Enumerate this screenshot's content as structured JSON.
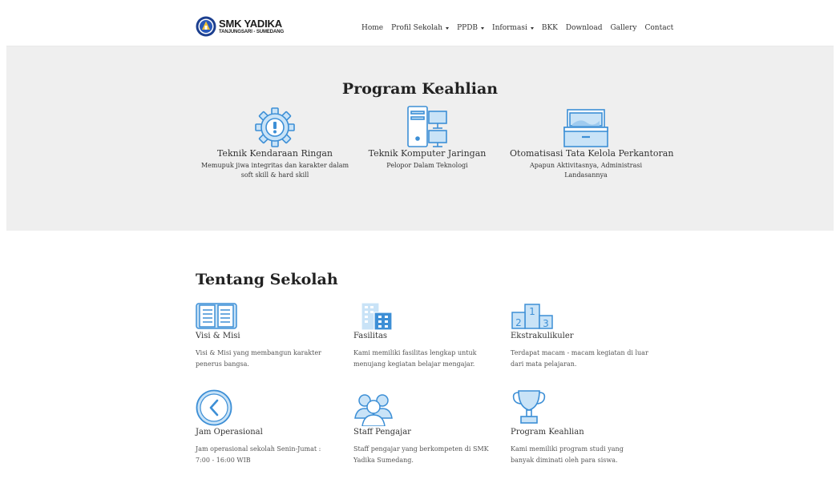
{
  "header": {
    "brand_name": "SMK YADIKA",
    "brand_sub": "TANJUNGSARI - SUMEDANG",
    "nav": [
      {
        "label": "Home",
        "dropdown": false
      },
      {
        "label": "Profil Sekolah",
        "dropdown": true
      },
      {
        "label": "PPDB",
        "dropdown": true
      },
      {
        "label": "Informasi",
        "dropdown": true
      },
      {
        "label": "BKK",
        "dropdown": false
      },
      {
        "label": "Download",
        "dropdown": false
      },
      {
        "label": "Gallery",
        "dropdown": false
      },
      {
        "label": "Contact",
        "dropdown": false
      }
    ]
  },
  "programs": {
    "title": "Program Keahlian",
    "items": [
      {
        "icon": "gear-icon",
        "name": "Teknik Kendaraan Ringan",
        "desc": "Memupuk jiwa integritas dan karakter dalam soft skill & hard skill"
      },
      {
        "icon": "computer-network-icon",
        "name": "Teknik Komputer Jaringan",
        "desc": "Pelopor Dalam Teknologi"
      },
      {
        "icon": "office-tray-icon",
        "name": "Otomatisasi Tata Kelola Perkantoran",
        "desc": "Apapun Aktivitasnya, Administrasi Landasannya"
      }
    ]
  },
  "about": {
    "title": "Tentang Sekolah",
    "items": [
      {
        "icon": "book-icon",
        "name": "Visi & Misi",
        "desc": "Visi & Misi yang membangun karakter penerus bangsa."
      },
      {
        "icon": "building-icon",
        "name": "Fasilitas",
        "desc": "Kami memiliki fasilitas lengkap untuk menujang kegiatan belajar mengajar."
      },
      {
        "icon": "podium-icon",
        "name": "Ekstrakulikuler",
        "desc": "Terdapat macam - macam kegiatan di luar dari mata pelajaran."
      },
      {
        "icon": "clock-icon",
        "name": "Jam Operasional",
        "desc": "Jam operasional sekolah Senin-Jumat : 7:00 - 16:00 WIB"
      },
      {
        "icon": "team-icon",
        "name": "Staff Pengajar",
        "desc": "Staff pengajar yang berkompeten di SMK Yadika Sumedang."
      },
      {
        "icon": "trophy-icon",
        "name": "Program Keahlian",
        "desc": "Kami memiliki program studi yang banyak diminati oleh para siswa."
      }
    ]
  },
  "colors": {
    "icon_stroke": "#3d8fd6",
    "icon_fill": "#c9e3f7",
    "band_bg": "#efefef"
  }
}
